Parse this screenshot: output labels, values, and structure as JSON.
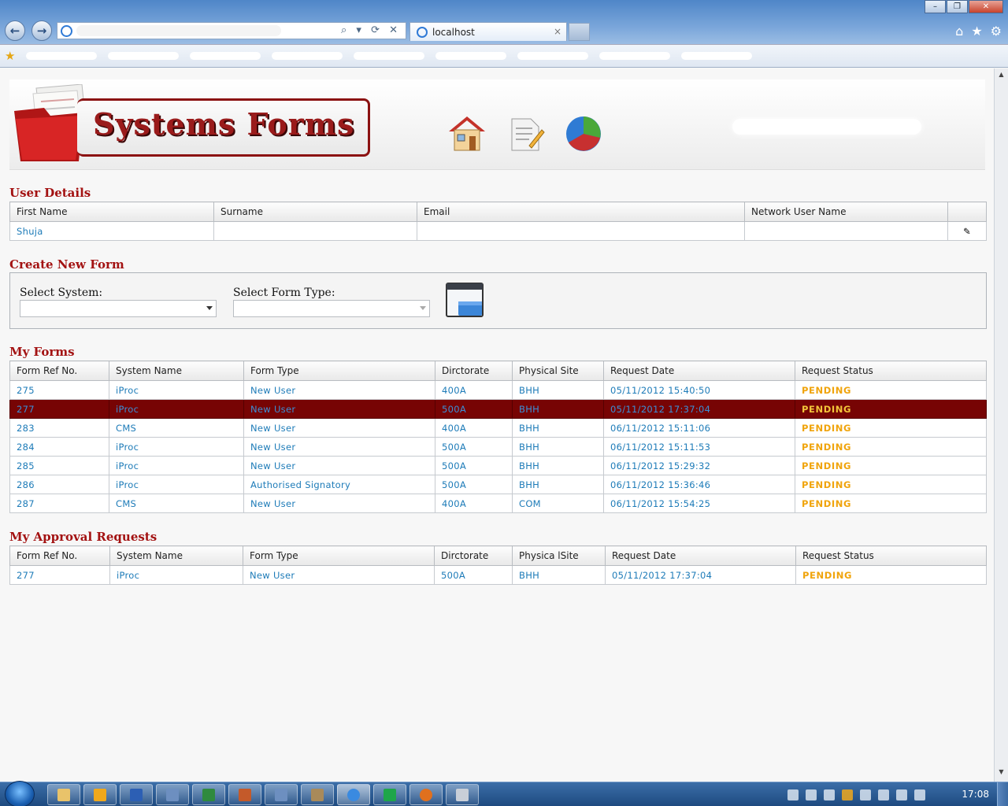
{
  "browser": {
    "tab_title": "localhost",
    "tab_close": "×",
    "back_glyph": "←",
    "forward_glyph": "→",
    "address_icons": "⌕ ▾ ⟳ ✕",
    "home_glyph": "⌂",
    "star_glyph": "★",
    "gear_glyph": "⚙",
    "win_min": "–",
    "win_restore": "❐",
    "win_close": "✕"
  },
  "app": {
    "title": "Systems Forms"
  },
  "user_details": {
    "title": "User Details",
    "columns": [
      "First Name",
      "Surname",
      "Email",
      "Network User Name"
    ],
    "row": {
      "first_name": "Shuja",
      "surname": "",
      "email": "",
      "network_user_name": ""
    },
    "edit_glyph": "✎"
  },
  "create_form": {
    "title": "Create New Form",
    "system_label": "Select System:",
    "form_type_label": "Select Form Type:",
    "system_value": "",
    "form_type_value": ""
  },
  "my_forms": {
    "title": "My Forms",
    "columns": [
      "Form Ref No.",
      "System Name",
      "Form Type",
      "Dirctorate",
      "Physical Site",
      "Request Date",
      "Request Status"
    ],
    "rows": [
      [
        "275",
        "iProc",
        "New User",
        "400A",
        "BHH",
        "05/11/2012 15:40:50",
        "PENDING"
      ],
      [
        "277",
        "iProc",
        "New User",
        "500A",
        "BHH",
        "05/11/2012 17:37:04",
        "PENDING"
      ],
      [
        "283",
        "CMS",
        "New User",
        "400A",
        "BHH",
        "06/11/2012 15:11:06",
        "PENDING"
      ],
      [
        "284",
        "iProc",
        "New User",
        "500A",
        "BHH",
        "06/11/2012 15:11:53",
        "PENDING"
      ],
      [
        "285",
        "iProc",
        "New User",
        "500A",
        "BHH",
        "06/11/2012 15:29:32",
        "PENDING"
      ],
      [
        "286",
        "iProc",
        "Authorised Signatory",
        "500A",
        "BHH",
        "06/11/2012 15:36:46",
        "PENDING"
      ],
      [
        "287",
        "CMS",
        "New User",
        "400A",
        "COM",
        "06/11/2012 15:54:25",
        "PENDING"
      ]
    ],
    "selected_row_ref": "277"
  },
  "approval_requests": {
    "title": "My Approval Requests",
    "columns": [
      "Form Ref No.",
      "System Name",
      "Form Type",
      "Dirctorate",
      "Physica lSite",
      "Request Date",
      "Request Status"
    ],
    "rows": [
      [
        "277",
        "iProc",
        "New User",
        "500A",
        "BHH",
        "05/11/2012 17:37:04",
        "PENDING"
      ]
    ]
  },
  "taskbar": {
    "clock": "17:08"
  },
  "colors": {
    "heading_red": "#a31212",
    "link_blue": "#1d7bb8",
    "pending_orange": "#f0a40c",
    "selected_row": "#770404"
  }
}
